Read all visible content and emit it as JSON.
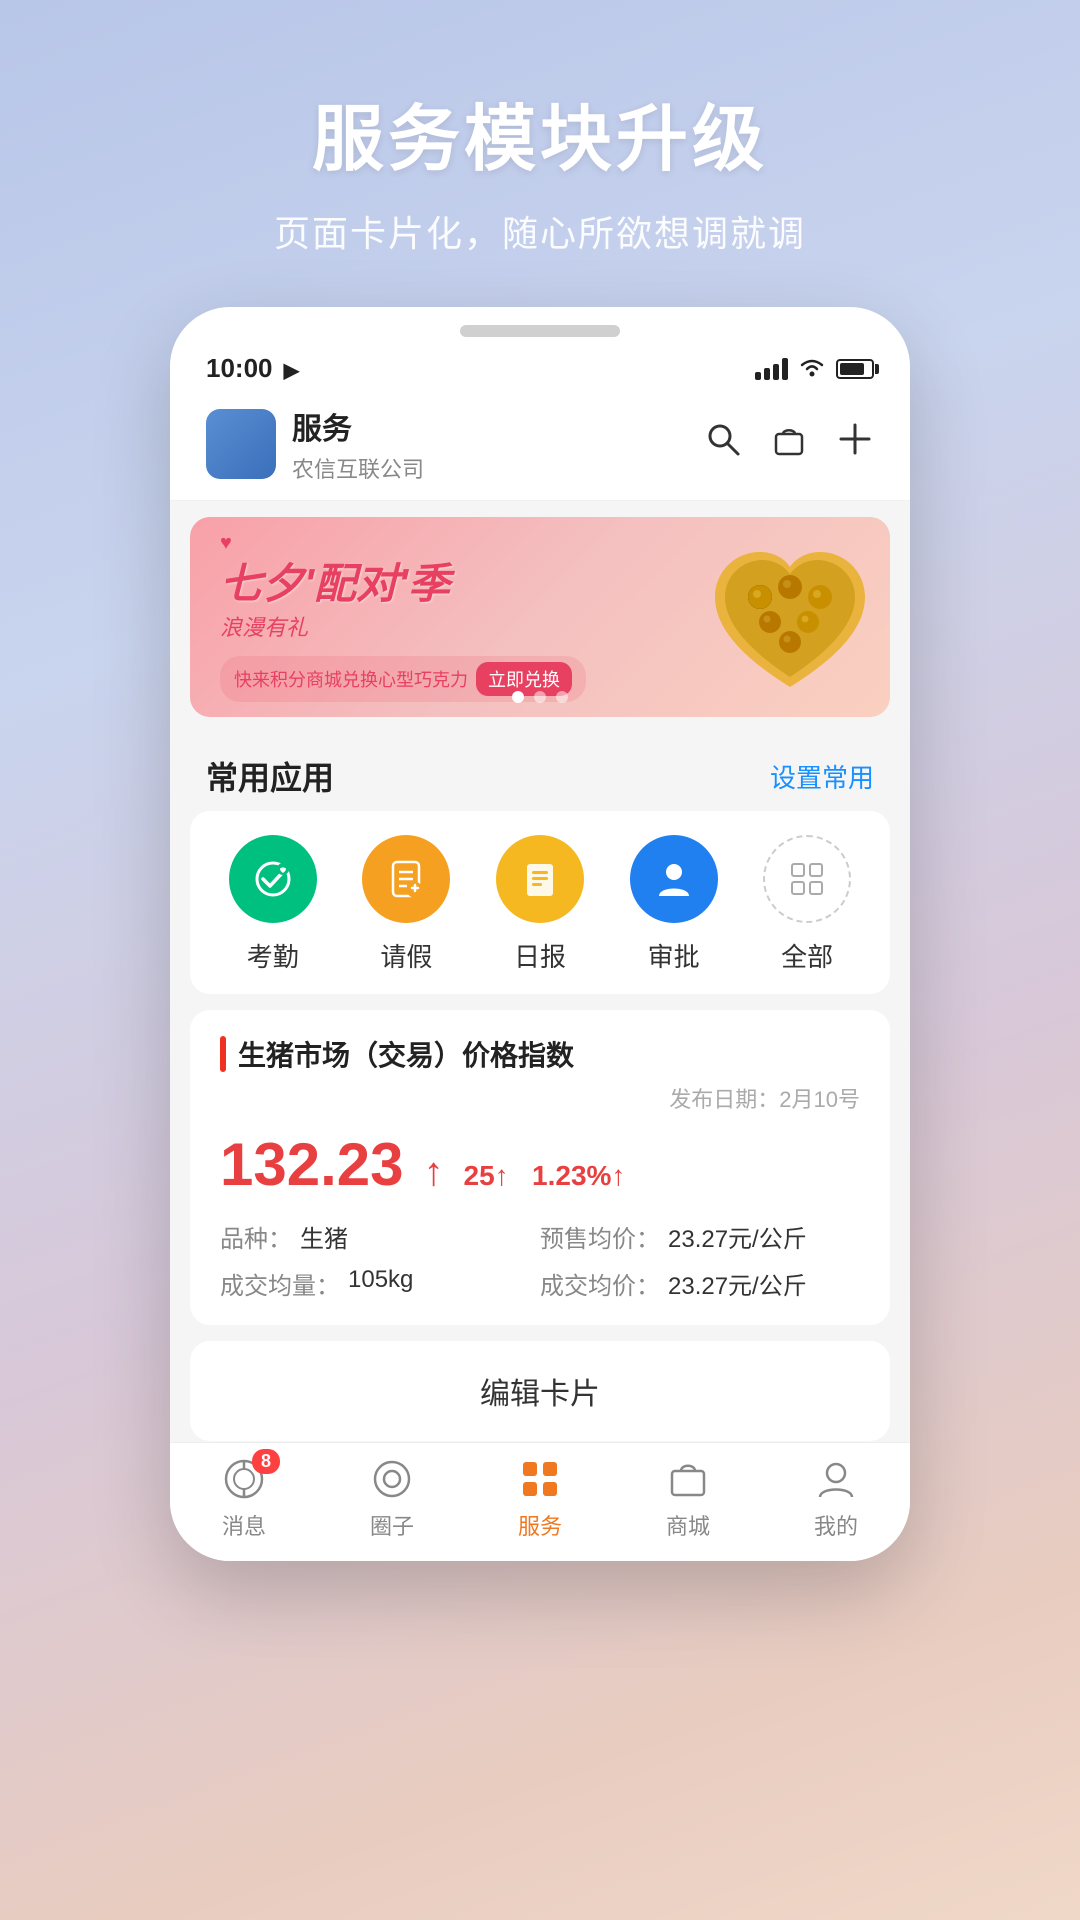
{
  "hero": {
    "title": "服务模块升级",
    "subtitle": "页面卡片化，随心所欲想调就调"
  },
  "statusBar": {
    "time": "10:00",
    "timeIcon": "▶"
  },
  "appHeader": {
    "title": "服务",
    "subtitle": "农信互联公司",
    "icons": [
      "search",
      "bag",
      "plus"
    ]
  },
  "banner": {
    "line1": "七夕'配对'季",
    "line2": "浪漫有礼",
    "badge_text": "快来积分商城兑换心型巧克力",
    "badge_cta": "立即兑换",
    "hearts": [
      "♥",
      "♥"
    ],
    "dots": [
      true,
      false,
      false
    ]
  },
  "commonApps": {
    "sectionTitle": "常用应用",
    "actionLabel": "设置常用",
    "items": [
      {
        "label": "考勤",
        "icon": "bluetooth",
        "color": "green"
      },
      {
        "label": "请假",
        "icon": "building",
        "color": "orange"
      },
      {
        "label": "日报",
        "icon": "clipboard",
        "color": "yellow"
      },
      {
        "label": "审批",
        "icon": "person",
        "color": "blue"
      },
      {
        "label": "全部",
        "icon": "grid",
        "color": "dashed"
      }
    ]
  },
  "priceCard": {
    "title": "生猪市场（交易）价格指数",
    "date": "发布日期：2月10号",
    "priceMain": "132.23",
    "priceArrow": "↑",
    "change1": "25↑",
    "change2": "1.23%↑",
    "details": [
      {
        "label": "品种：",
        "value": "生猪"
      },
      {
        "label": "预售均价：",
        "value": "23.27元/公斤"
      },
      {
        "label": "成交均量：",
        "value": "105kg"
      },
      {
        "label": "成交均价：",
        "value": "23.27元/公斤"
      }
    ]
  },
  "editCard": {
    "label": "编辑卡片"
  },
  "tabBar": {
    "items": [
      {
        "label": "消息",
        "icon": "message",
        "badge": "8",
        "active": false
      },
      {
        "label": "圈子",
        "icon": "circle",
        "badge": null,
        "active": false
      },
      {
        "label": "服务",
        "icon": "apps",
        "badge": null,
        "active": true
      },
      {
        "label": "商城",
        "icon": "shop",
        "badge": null,
        "active": false
      },
      {
        "label": "我的",
        "icon": "person",
        "badge": null,
        "active": false
      }
    ]
  }
}
